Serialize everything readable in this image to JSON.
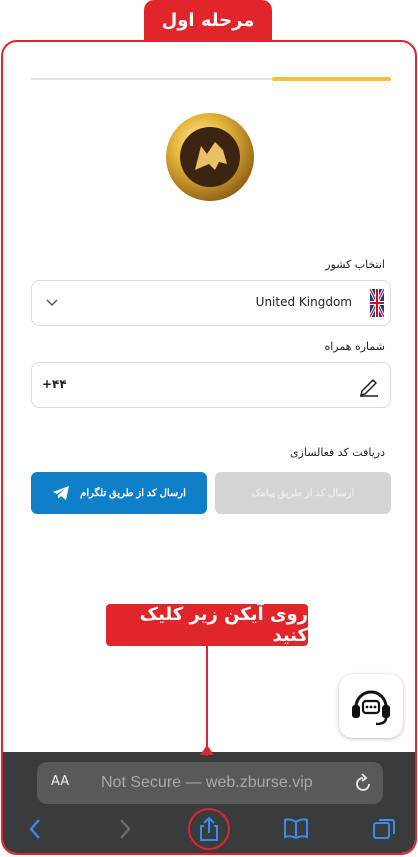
{
  "stage_tab": "مرحله اول",
  "progress": {
    "fraction": 0.33,
    "color": "#f2c23a"
  },
  "country": {
    "label": "انتخاب کشور",
    "value": "United Kingdom"
  },
  "phone": {
    "label": "شماره همراه",
    "prefix": "+۴۴"
  },
  "activation": {
    "label": "دریافت کد فعالسازی",
    "sms_button": "ارسال کد از طریق پیامک",
    "telegram_button": "ارسال کد از طریق تلگرام"
  },
  "callout": "روی آیکن زیر  کلیک کنید",
  "browser": {
    "aa": "AA",
    "url": "Not Secure — web.zburse.vip"
  },
  "icons": {
    "logo": "wolf-coin-logo",
    "flag": "uk-flag-icon",
    "chevron": "chevron-down-icon",
    "pencil": "pencil-icon",
    "telegram": "telegram-icon",
    "support": "support-headset-icon",
    "reload": "reload-icon",
    "back": "back-icon",
    "forward": "forward-icon",
    "share": "share-icon",
    "bookmarks": "bookmarks-icon",
    "tabs": "tabs-icon"
  },
  "colors": {
    "accent": "#e0252b",
    "telegram_blue": "#0d80c9",
    "gold": "#f2c23a"
  }
}
